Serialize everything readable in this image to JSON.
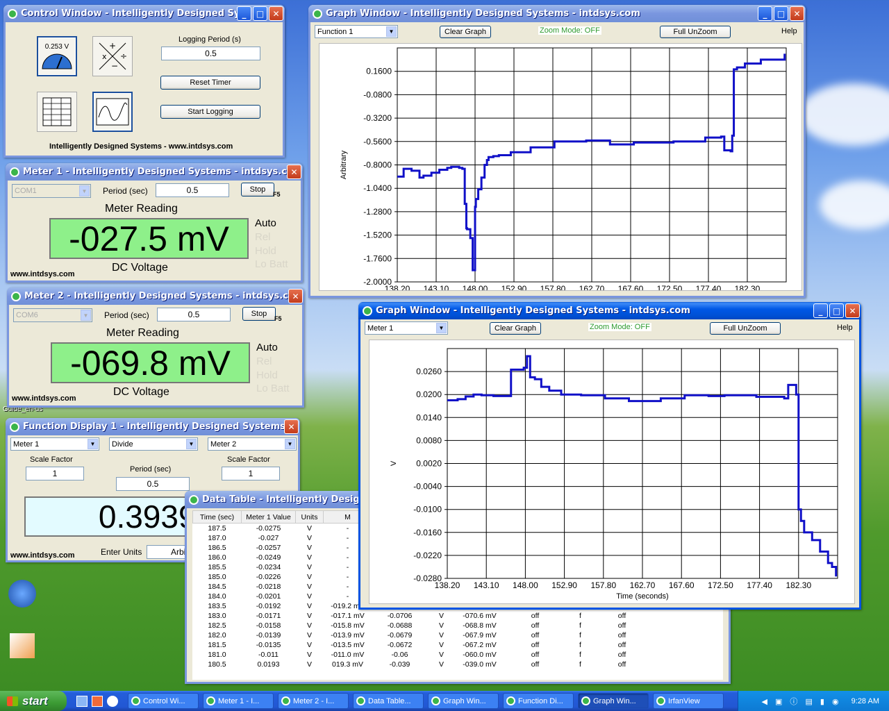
{
  "control": {
    "title": "Control Window - Intelligently Designed Systems",
    "meter_tile_value": "0.253 V",
    "logging_period_label": "Logging Period (s)",
    "logging_period": "0.5",
    "reset_label": "Reset Timer",
    "start_label": "Start Logging",
    "footer": "Intelligently Designed Systems - www.intdsys.com"
  },
  "meter1": {
    "title": "Meter 1 - Intelligently Designed Systems - intdsys.com",
    "port": "COM1",
    "period_label": "Period (sec)",
    "period": "0.5",
    "stop_label": "Stop",
    "hotkey": "F5",
    "reading_label": "Meter Reading",
    "reading": "-027.5 mV",
    "mode": "DC Voltage",
    "auto": "Auto",
    "rel": "Rel",
    "hold": "Hold",
    "lobatt": "Lo Batt",
    "url": "www.intdsys.com"
  },
  "meter2": {
    "title": "Meter 2 - Intelligently Designed Systems - intdsys.com",
    "port": "COM6",
    "period_label": "Period (sec)",
    "period": "0.5",
    "stop_label": "Stop",
    "hotkey": "F5",
    "reading_label": "Meter Reading",
    "reading": "-069.8 mV",
    "mode": "DC Voltage",
    "auto": "Auto",
    "rel": "Rel",
    "hold": "Hold",
    "lobatt": "Lo Batt",
    "url": "www.intdsys.com"
  },
  "func": {
    "title": "Function Display 1 - Intelligently Designed Systems",
    "input_a": "Meter 1",
    "operation": "Divide",
    "input_b": "Meter 2",
    "scale_label": "Scale Factor",
    "scale_a": "1",
    "scale_b": "1",
    "period_label": "Period (sec)",
    "period": "0.5",
    "value": "0.39398",
    "url": "www.intdsys.com",
    "units_label": "Enter Units",
    "units": "Arbi"
  },
  "table": {
    "title": "Data Table - Intelligently Designed Sy",
    "headers": [
      "Time (sec)",
      "Meter 1 Value",
      "Units",
      "M",
      "",
      "",
      "",
      "",
      "",
      ""
    ],
    "rows": [
      [
        "187.5",
        "-0.0275",
        "V",
        "-",
        "",
        "",
        "",
        "",
        "",
        ""
      ],
      [
        "187.0",
        "-0.027",
        "V",
        "-",
        "",
        "",
        "",
        "",
        "",
        ""
      ],
      [
        "186.5",
        "-0.0257",
        "V",
        "-",
        "",
        "",
        "",
        "",
        "",
        ""
      ],
      [
        "186.0",
        "-0.0249",
        "V",
        "-",
        "",
        "",
        "",
        "",
        "",
        ""
      ],
      [
        "185.5",
        "-0.0234",
        "V",
        "-",
        "",
        "",
        "",
        "",
        "",
        ""
      ],
      [
        "185.0",
        "-0.0226",
        "V",
        "-",
        "",
        "",
        "",
        "",
        "",
        ""
      ],
      [
        "184.5",
        "-0.0218",
        "V",
        "-",
        "",
        "",
        "",
        "",
        "",
        ""
      ],
      [
        "184.0",
        "-0.0201",
        "V",
        "-",
        "",
        "",
        "",
        "",
        "",
        ""
      ],
      [
        "183.5",
        "-0.0192",
        "V",
        "-019.2 mV",
        "-0.0711",
        "V",
        "-071.1 mV",
        "off",
        "f",
        "off"
      ],
      [
        "183.0",
        "-0.0171",
        "V",
        "-017.1 mV",
        "-0.0706",
        "V",
        "-070.6 mV",
        "off",
        "f",
        "off"
      ],
      [
        "182.5",
        "-0.0158",
        "V",
        "-015.8 mV",
        "-0.0688",
        "V",
        "-068.8 mV",
        "off",
        "f",
        "off"
      ],
      [
        "182.0",
        "-0.0139",
        "V",
        "-013.9 mV",
        "-0.0679",
        "V",
        "-067.9 mV",
        "off",
        "f",
        "off"
      ],
      [
        "181.5",
        "-0.0135",
        "V",
        "-013.5 mV",
        "-0.0672",
        "V",
        "-067.2 mV",
        "off",
        "f",
        "off"
      ],
      [
        "181.0",
        "-0.011",
        "V",
        "-011.0 mV",
        "-0.06",
        "V",
        "-060.0 mV",
        "off",
        "f",
        "off"
      ],
      [
        "180.5",
        "0.0193",
        "V",
        "019.3 mV",
        "-0.039",
        "V",
        "-039.0 mV",
        "off",
        "f",
        "off"
      ]
    ]
  },
  "graph1": {
    "title": "Graph Window - Intelligently Designed Systems - intdsys.com",
    "source": "Function 1",
    "clear_label": "Clear Graph",
    "zoom_mode": "Zoom Mode: OFF",
    "unzoom_label": "Full UnZoom",
    "help": "Help"
  },
  "graph2": {
    "title": "Graph Window - Intelligently Designed Systems - intdsys.com",
    "source": "Meter 1",
    "clear_label": "Clear Graph",
    "zoom_mode": "Zoom Mode: OFF",
    "unzoom_label": "Full UnZoom",
    "help": "Help"
  },
  "chart_data": [
    {
      "type": "line",
      "ylabel": "Arbitrary",
      "xlabel": "",
      "xlim": [
        138.2,
        187.2
      ],
      "ylim": [
        -2.0,
        0.4
      ],
      "xticks": [
        "138.20",
        "143.10",
        "148.00",
        "152.90",
        "157.80",
        "162.70",
        "167.60",
        "172.50",
        "177.40",
        "182.30"
      ],
      "yticks": [
        "0.1600",
        "-0.0800",
        "-0.3200",
        "-0.5600",
        "-0.8000",
        "-1.0400",
        "-1.2800",
        "-1.5200",
        "-1.7600",
        "-2.0000"
      ],
      "series": [
        {
          "color": "#1010c8",
          "x": [
            138.2,
            139.0,
            140.0,
            141.0,
            141.5,
            142.5,
            143.5,
            144.5,
            145.0,
            146.0,
            146.4,
            146.7,
            146.9,
            147.0,
            147.4,
            147.7,
            147.8,
            148.0,
            148.1,
            148.4,
            148.8,
            149.2,
            149.5,
            149.7,
            150.3,
            151.0,
            152.5,
            155.0,
            158.0,
            160.0,
            162.0,
            165.0,
            168.0,
            170.0,
            173.0,
            177.0,
            179.0,
            179.4,
            180.2,
            180.4,
            180.6,
            181.0,
            182.0,
            184.0,
            187.0
          ],
          "y": [
            -0.92,
            -0.84,
            -0.86,
            -0.93,
            -0.91,
            -0.88,
            -0.85,
            -0.83,
            -0.82,
            -0.83,
            -0.84,
            -1.2,
            -1.45,
            -1.46,
            -1.55,
            -1.88,
            -1.88,
            -1.23,
            -1.15,
            -1.05,
            -0.93,
            -0.8,
            -0.75,
            -0.72,
            -0.71,
            -0.7,
            -0.67,
            -0.62,
            -0.56,
            -0.56,
            -0.55,
            -0.59,
            -0.57,
            -0.57,
            -0.56,
            -0.52,
            -0.51,
            -0.65,
            -0.66,
            -0.5,
            0.18,
            0.2,
            0.24,
            0.28,
            0.34
          ]
        }
      ]
    },
    {
      "type": "line",
      "ylabel": "V",
      "xlabel": "Time (seconds)",
      "xlim": [
        138.2,
        187.2
      ],
      "ylim": [
        -0.028,
        0.032
      ],
      "xticks": [
        "138.20",
        "143.10",
        "148.00",
        "152.90",
        "157.80",
        "162.70",
        "167.60",
        "172.50",
        "177.40",
        "182.30"
      ],
      "yticks": [
        "0.0260",
        "0.0200",
        "0.0140",
        "0.0080",
        "0.0020",
        "-0.0040",
        "-0.0100",
        "-0.0160",
        "-0.0220",
        "-0.0280"
      ],
      "series": [
        {
          "color": "#1010c8",
          "x": [
            138.2,
            139.5,
            140.5,
            141.5,
            142.5,
            144.0,
            146.0,
            146.2,
            147.8,
            148.2,
            148.6,
            149.2,
            150.0,
            151.0,
            152.5,
            155.0,
            158.0,
            161.0,
            163.0,
            165.0,
            168.0,
            171.0,
            173.0,
            177.0,
            180.5,
            181.0,
            181.5,
            182.0,
            182.3,
            182.6,
            183.0,
            184.0,
            185.0,
            186.0,
            186.5,
            187.0
          ],
          "y": [
            0.0185,
            0.0188,
            0.0195,
            0.02,
            0.0198,
            0.0196,
            0.0196,
            0.0265,
            0.027,
            0.03,
            0.0245,
            0.024,
            0.022,
            0.021,
            0.02,
            0.0198,
            0.019,
            0.0183,
            0.0183,
            0.019,
            0.0198,
            0.0196,
            0.0198,
            0.0194,
            0.019,
            0.0225,
            0.0225,
            0.02,
            -0.01,
            -0.013,
            -0.016,
            -0.018,
            -0.021,
            -0.024,
            -0.025,
            -0.0275
          ]
        }
      ]
    }
  ],
  "desktop": {
    "icon1": "Guide_en-us",
    "icon2": "",
    "icon3": ""
  },
  "taskbar": {
    "start": "start",
    "buttons": [
      "Control Wi...",
      "Meter 1 - I...",
      "Meter 2 - I...",
      "Data Table...",
      "Graph Win...",
      "Function Di...",
      "Graph Win...",
      "IrfanView"
    ],
    "clock": "9:28 AM"
  }
}
